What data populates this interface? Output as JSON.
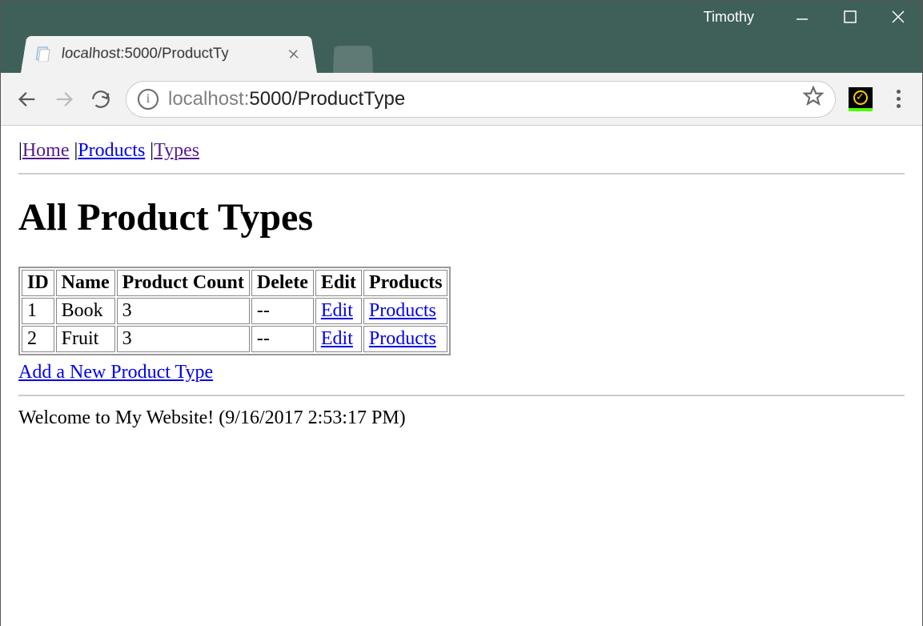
{
  "window": {
    "username": "Timothy"
  },
  "browser": {
    "tab_title": "localhost:5000/ProductTy",
    "url_display_host": "localhost:",
    "url_display_rest": "5000/ProductType"
  },
  "nav": {
    "sep": "|",
    "home": "Home",
    "products": "Products",
    "types": "Types"
  },
  "page": {
    "heading": "All Product Types",
    "add_link": "Add a New Product Type",
    "welcome": "Welcome to My Website! (9/16/2017 2:53:17 PM)"
  },
  "table": {
    "headers": [
      "ID",
      "Name",
      "Product Count",
      "Delete",
      "Edit",
      "Products"
    ],
    "rows": [
      {
        "id": "1",
        "name": "Book",
        "count": "3",
        "delete": "--",
        "edit": "Edit",
        "products": "Products"
      },
      {
        "id": "2",
        "name": "Fruit",
        "count": "3",
        "delete": "--",
        "edit": "Edit",
        "products": "Products"
      }
    ]
  }
}
